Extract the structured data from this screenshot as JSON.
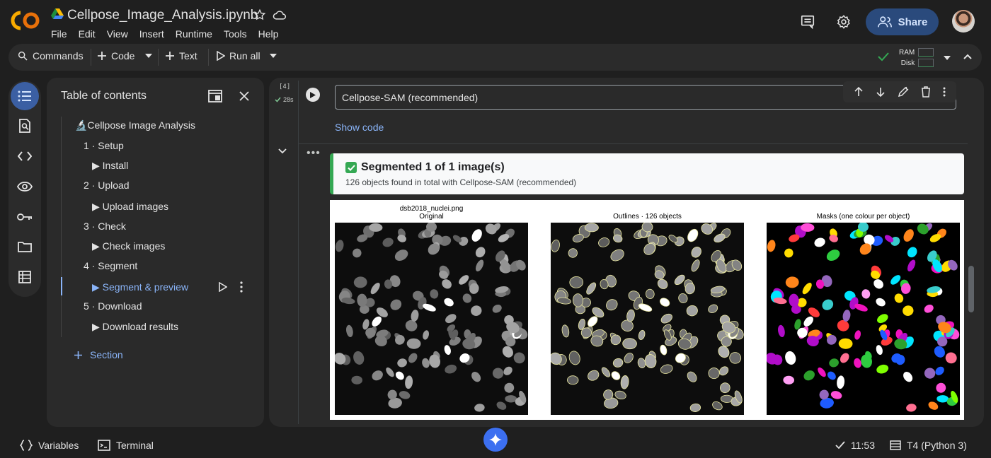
{
  "header": {
    "title": "Cellpose_Image_Analysis.ipynb",
    "menu": [
      "File",
      "Edit",
      "View",
      "Insert",
      "Runtime",
      "Tools",
      "Help"
    ],
    "share_label": "Share"
  },
  "toolbar": {
    "commands_label": "Commands",
    "code_label": "Code",
    "text_label": "Text",
    "run_all_label": "Run all",
    "ram_label": "RAM",
    "disk_label": "Disk"
  },
  "toc": {
    "title": "Table of contents",
    "items": [
      {
        "label": "🔬Cellpose Image Analysis"
      },
      {
        "label": "1 · Setup"
      },
      {
        "label": "▶ Install"
      },
      {
        "label": "2 · Upload"
      },
      {
        "label": "▶ Upload images"
      },
      {
        "label": "3 · Check"
      },
      {
        "label": "▶ Check images"
      },
      {
        "label": "4 · Segment"
      },
      {
        "label": "▶ Segment & preview"
      },
      {
        "label": "5 · Download"
      },
      {
        "label": "▶ Download results"
      }
    ],
    "add_section_label": "Section"
  },
  "cell": {
    "exec_count": "[4]",
    "exec_time": "28s",
    "form_value": "Cellpose-SAM (recommended)",
    "show_code_label": "Show code"
  },
  "output": {
    "result_title": "Segmented 1 of 1 image(s)",
    "result_subtitle": "126 objects found in total with Cellpose-SAM (recommended)",
    "panels": [
      {
        "title_line1": "dsb2018_nuclei.png",
        "title_line2": "Original"
      },
      {
        "title_line1": "Outlines · 126 objects",
        "title_line2": ""
      },
      {
        "title_line1": "Masks (one colour per object)",
        "title_line2": ""
      }
    ]
  },
  "status": {
    "variables_label": "Variables",
    "terminal_label": "Terminal",
    "time": "11:53",
    "runtime_label": "T4 (Python 3)"
  },
  "colors": {
    "accent": "#8ab4f8",
    "share_bg": "#2a4a7c",
    "success": "#34a853"
  }
}
